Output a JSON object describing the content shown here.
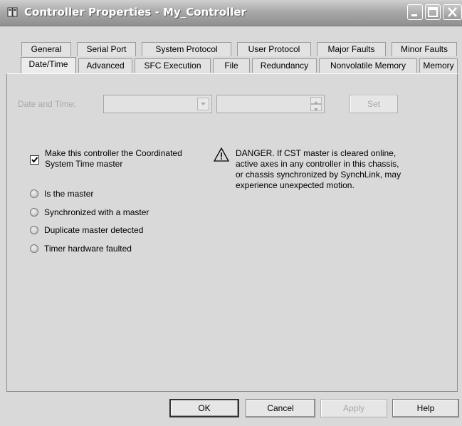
{
  "window": {
    "title": "Controller Properties - My_Controller",
    "app_icon": "controller-icon",
    "buttons": [
      "minimize",
      "maximize",
      "close"
    ]
  },
  "tabs": {
    "row1": [
      "General",
      "Serial Port",
      "System Protocol",
      "User Protocol",
      "Major Faults",
      "Minor Faults"
    ],
    "row2": [
      "Date/Time",
      "Advanced",
      "SFC Execution",
      "File",
      "Redundancy",
      "Nonvolatile Memory",
      "Memory"
    ],
    "active": "Date/Time"
  },
  "datetime": {
    "label": "Date and Time:",
    "date_value": "",
    "time_value": "",
    "set_label": "Set"
  },
  "cst": {
    "checkbox_checked": true,
    "checkbox_label_line1": "Make this controller the Coordinated",
    "checkbox_label_line2": "System Time master",
    "warning_icon": "warning-icon",
    "warning_line1": "DANGER. If CST master is cleared online,",
    "warning_line2": "active axes in any controller in this chassis,",
    "warning_line3": "or chassis synchronized by SynchLink, may",
    "warning_line4": "experience unexpected motion."
  },
  "status": [
    "Is the master",
    "Synchronized with a master",
    "Duplicate master detected",
    "Timer hardware faulted"
  ],
  "footer": {
    "ok": "OK",
    "cancel": "Cancel",
    "apply": "Apply",
    "help": "Help"
  },
  "colors": {
    "window_bg": "#d9d9d9",
    "disabled_text": "#a8a8a8"
  }
}
